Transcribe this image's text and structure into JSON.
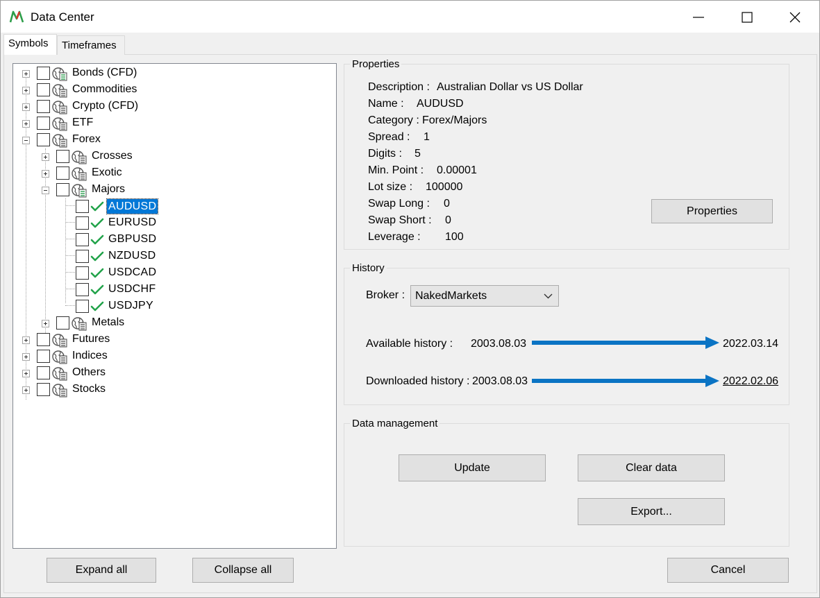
{
  "window": {
    "title": "Data Center",
    "accent": "#0078d7"
  },
  "tabs": [
    {
      "label": "Symbols",
      "active": true
    },
    {
      "label": "Timeframes",
      "active": false
    }
  ],
  "tree": {
    "top_level": [
      {
        "label": "Bonds (CFD)",
        "icon": "globe-icon",
        "expanded": false
      },
      {
        "label": "Commodities",
        "icon": "globe-icon",
        "expanded": false
      },
      {
        "label": "Crypto (CFD)",
        "icon": "globe-icon",
        "expanded": false
      },
      {
        "label": "ETF",
        "icon": "globe-icon",
        "expanded": false
      },
      {
        "label": "Forex",
        "icon": "globe-icon",
        "expanded": true
      },
      {
        "label": "Futures",
        "icon": "globe-icon",
        "expanded": false
      },
      {
        "label": "Indices",
        "icon": "globe-icon",
        "expanded": false
      },
      {
        "label": "Others",
        "icon": "globe-icon",
        "expanded": false
      },
      {
        "label": "Stocks",
        "icon": "globe-icon",
        "expanded": false
      }
    ],
    "forex_children": [
      {
        "label": "Crosses",
        "expanded": false
      },
      {
        "label": "Exotic",
        "expanded": false
      },
      {
        "label": "Majors",
        "expanded": true
      },
      {
        "label": "Metals",
        "expanded": false
      }
    ],
    "majors_symbols": [
      {
        "label": "AUDUSD",
        "selected": true
      },
      {
        "label": "EURUSD",
        "selected": false
      },
      {
        "label": "GBPUSD",
        "selected": false
      },
      {
        "label": "NZDUSD",
        "selected": false
      },
      {
        "label": "USDCAD",
        "selected": false
      },
      {
        "label": "USDCHF",
        "selected": false
      },
      {
        "label": "USDJPY",
        "selected": false
      }
    ],
    "expand_all_label": "Expand all",
    "collapse_all_label": "Collapse all"
  },
  "properties": {
    "group_title": "Properties",
    "rows": [
      {
        "key": "Description :",
        "value": "Australian Dollar vs US Dollar"
      },
      {
        "key": "Name :",
        "value": "AUDUSD"
      },
      {
        "key": "Category :",
        "value": "Forex/Majors"
      },
      {
        "key": "Spread :",
        "value": "1"
      },
      {
        "key": "Digits :",
        "value": "5"
      },
      {
        "key": "Min. Point :",
        "value": "0.00001"
      },
      {
        "key": "Lot size :",
        "value": "100000"
      },
      {
        "key": "Swap Long :",
        "value": "0"
      },
      {
        "key": "Swap Short :",
        "value": "0"
      },
      {
        "key": "Leverage :",
        "value": "100"
      }
    ],
    "button_label": "Properties"
  },
  "history": {
    "group_title": "History",
    "broker_label": "Broker :",
    "broker_value": "NakedMarkets",
    "available_label": "Available history :",
    "available_from": "2003.08.03",
    "available_to": "2022.03.14",
    "downloaded_label": "Downloaded history :",
    "downloaded_from": "2003.08.03",
    "downloaded_to": "2022.02.06",
    "arrow_color": "#0b74c4"
  },
  "data_management": {
    "group_title": "Data management",
    "update_label": "Update",
    "clear_label": "Clear data",
    "export_label": "Export..."
  },
  "footer": {
    "cancel_label": "Cancel"
  }
}
